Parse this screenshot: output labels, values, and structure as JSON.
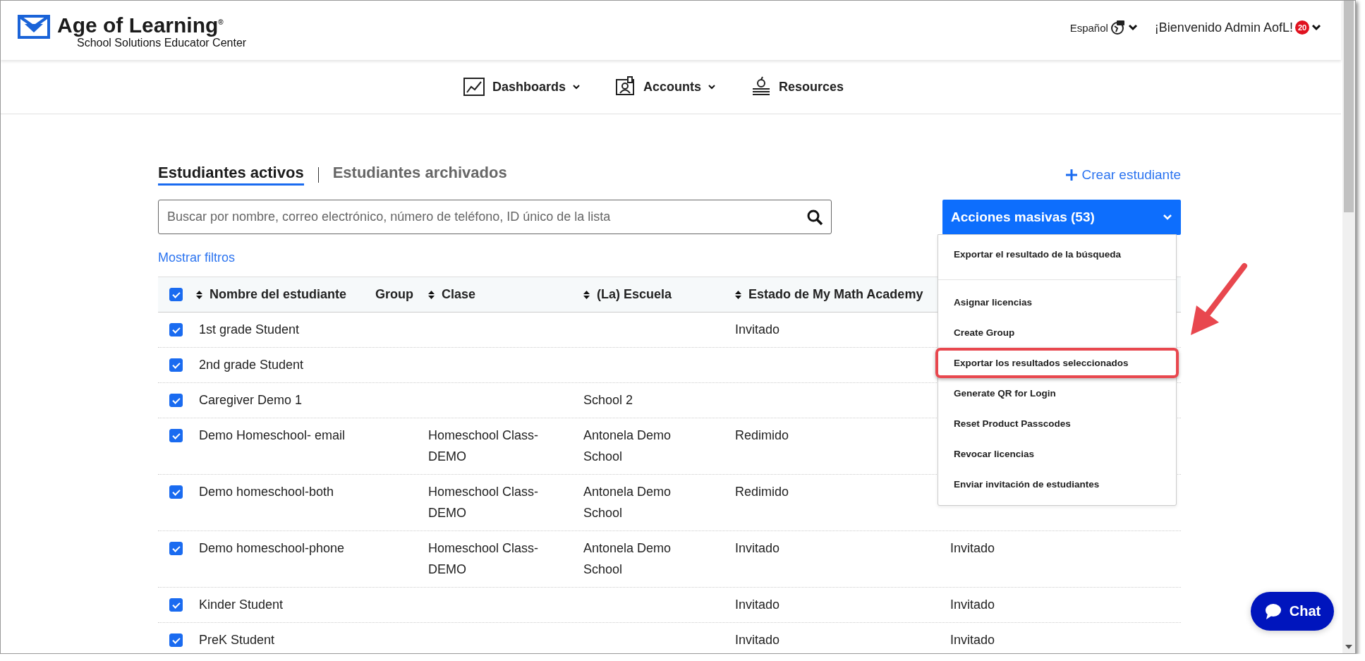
{
  "header": {
    "brand": "Age of Learning$^{®}$",
    "subtitle": "School Solutions Educator Center",
    "language": "Español",
    "welcome": "¡Bienvenido Admin AofL!",
    "notification_count": "20"
  },
  "nav": [
    {
      "label": "Dashboards",
      "kind": "chart",
      "dropdown": true
    },
    {
      "label": "Accounts",
      "kind": "person",
      "dropdown": true
    },
    {
      "label": "Resources",
      "kind": "books",
      "dropdown": false
    }
  ],
  "tabs": [
    {
      "label": "Estudiantes activos",
      "selected": true
    },
    {
      "label": "Estudiantes archivados",
      "selected": false
    }
  ],
  "create_link": "Crear estudiante",
  "search": {
    "placeholder": "Buscar por nombre, correo electrónico, número de teléfono, ID único de la lista"
  },
  "filters_link": "Mostrar filtros",
  "bulk_actions": {
    "label": "Acciones masivas (53)",
    "expanded": true,
    "items": [
      {
        "label": "Exportar el resultado de la búsqueda",
        "highlighted": false
      },
      {
        "label": "Asignar licencias",
        "highlighted": false
      },
      {
        "label": "Create Group",
        "highlighted": false
      },
      {
        "label": "Exportar los resultados seleccionados",
        "highlighted": true
      },
      {
        "label": "Generate QR for Login",
        "highlighted": false
      },
      {
        "label": "Reset Product Passcodes",
        "highlighted": false
      },
      {
        "label": "Revocar licencias",
        "highlighted": false
      },
      {
        "label": "Enviar invitación de estudiantes",
        "highlighted": false
      }
    ]
  },
  "table": {
    "all_checked": true,
    "columns": [
      {
        "label": "Nombre del estudiante",
        "sortable": true
      },
      {
        "label": "Group",
        "sortable": false
      },
      {
        "label": "Clase",
        "sortable": true
      },
      {
        "label": "(La) Escuela",
        "sortable": true
      },
      {
        "label": "Estado de My Math Academy",
        "sortable": true
      }
    ],
    "rows": [
      {
        "checked": true,
        "cells": [
          "1st grade Student",
          "",
          "",
          "",
          "Invitado",
          ""
        ]
      },
      {
        "checked": true,
        "cells": [
          "2nd grade Student",
          "",
          "",
          "",
          "",
          ""
        ]
      },
      {
        "checked": true,
        "cells": [
          "Caregiver Demo 1",
          "",
          "",
          "School 2",
          "",
          ""
        ]
      },
      {
        "checked": true,
        "cells": [
          "Demo Homeschool- email",
          "",
          "Homeschool Class-DEMO",
          "Antonela Demo School",
          "Redimido",
          ""
        ]
      },
      {
        "checked": true,
        "cells": [
          "Demo homeschool-both",
          "",
          "Homeschool Class-DEMO",
          "Antonela Demo School",
          "Redimido",
          ""
        ]
      },
      {
        "checked": true,
        "cells": [
          "Demo homeschool-phone",
          "",
          "Homeschool Class-DEMO",
          "Antonela Demo School",
          "Invitado",
          "Invitado"
        ]
      },
      {
        "checked": true,
        "cells": [
          "Kinder Student",
          "",
          "",
          "",
          "Invitado",
          "Invitado"
        ]
      },
      {
        "checked": true,
        "cells": [
          "PreK Student",
          "",
          "",
          "",
          "Invitado",
          "Invitado"
        ]
      }
    ]
  },
  "chat_button": "Chat"
}
